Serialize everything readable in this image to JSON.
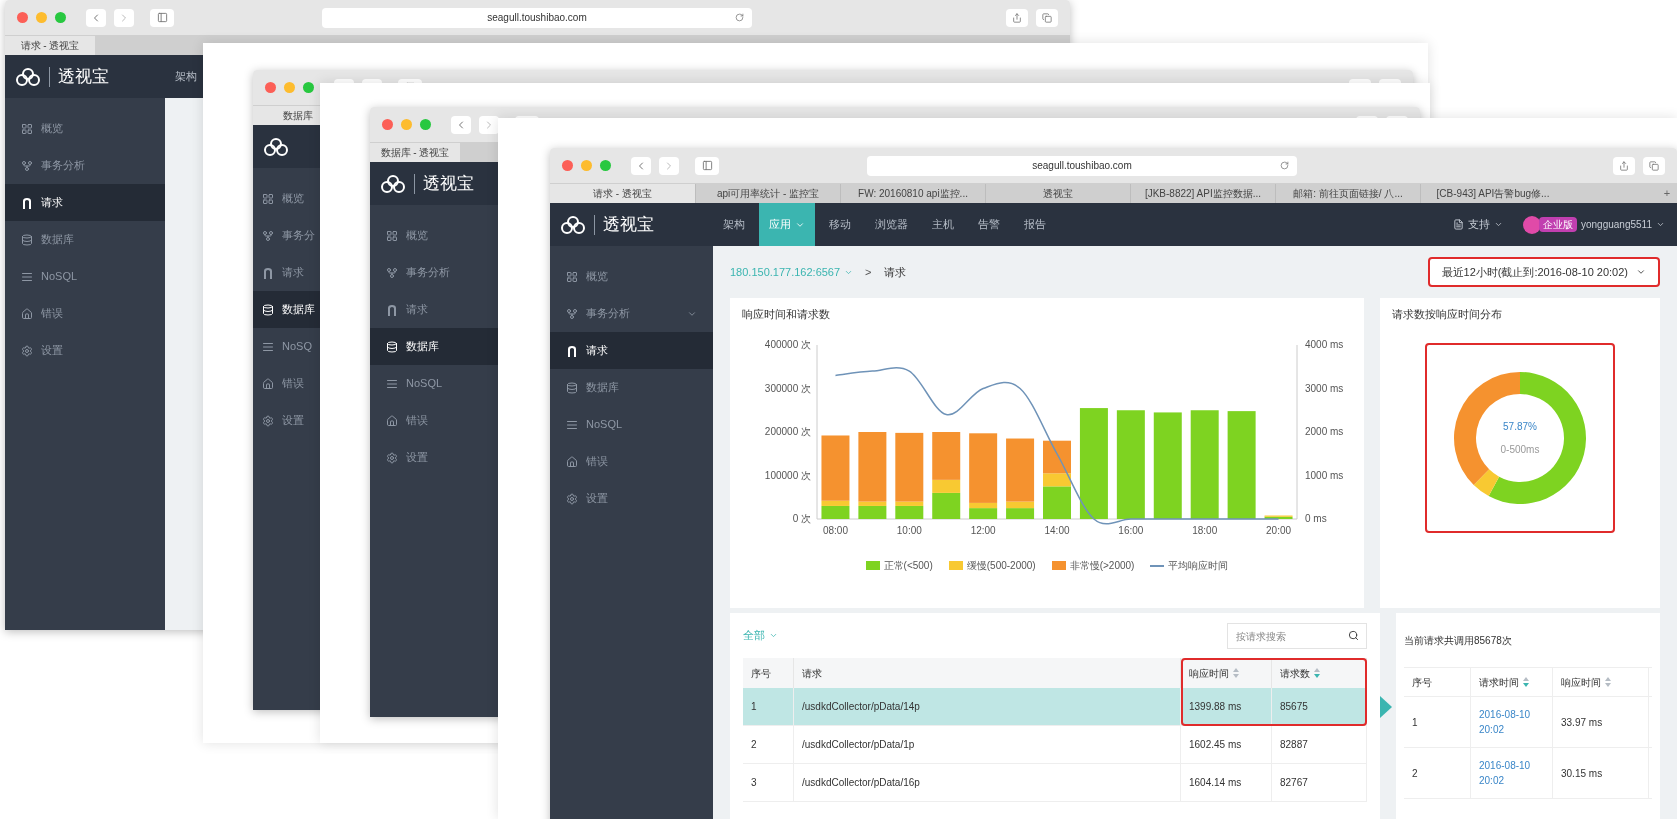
{
  "windows": [
    {
      "tabs": [
        {
          "label": "请求 - 透视宝",
          "selected": true
        }
      ],
      "url": "seagull.toushibao.com",
      "logo": "透视宝",
      "nav": [
        {
          "label": "架构",
          "selected": false
        }
      ],
      "sidebar": [
        {
          "kind": "overview",
          "label": "概览",
          "selected": false
        },
        {
          "kind": "transactions",
          "label": "事务分析",
          "selected": false
        },
        {
          "kind": "requests",
          "label": "请求",
          "selected": true
        },
        {
          "kind": "database",
          "label": "数据库",
          "selected": false
        },
        {
          "kind": "nosql",
          "label": "NoSQL",
          "selected": false
        },
        {
          "kind": "errors",
          "label": "错误",
          "selected": false
        },
        {
          "kind": "settings",
          "label": "设置",
          "selected": false
        }
      ]
    },
    {
      "tabs": [
        {
          "label": "数据库",
          "selected": true
        }
      ],
      "sidebar": [
        {
          "kind": "overview",
          "label": "概览",
          "selected": false
        },
        {
          "kind": "transactions",
          "label": "事务分",
          "selected": false
        },
        {
          "kind": "requests",
          "label": "请求",
          "selected": false
        },
        {
          "kind": "database",
          "label": "数据库",
          "selected": true
        },
        {
          "kind": "nosql",
          "label": "NoSQ",
          "selected": false
        },
        {
          "kind": "errors",
          "label": "错误",
          "selected": false
        },
        {
          "kind": "settings",
          "label": "设置",
          "selected": false
        }
      ]
    },
    {
      "tabs": [
        {
          "label": "数据库 - 透视宝",
          "selected": true
        }
      ],
      "logo": "透视宝",
      "sidebar": [
        {
          "kind": "overview",
          "label": "概览",
          "selected": false
        },
        {
          "kind": "transactions",
          "label": "事务分析",
          "selected": false
        },
        {
          "kind": "requests",
          "label": "请求",
          "selected": false
        },
        {
          "kind": "database",
          "label": "数据库",
          "selected": true
        },
        {
          "kind": "nosql",
          "label": "NoSQL",
          "selected": false
        },
        {
          "kind": "errors",
          "label": "错误",
          "selected": false
        },
        {
          "kind": "settings",
          "label": "设置",
          "selected": false
        }
      ]
    },
    {
      "tabs": [
        {
          "label": "请求 - 透视宝",
          "selected": true
        },
        {
          "label": "api可用率统计 - 监控宝",
          "selected": false
        },
        {
          "label": "FW: 20160810 api监控...",
          "selected": false
        },
        {
          "label": "透视宝",
          "selected": false
        },
        {
          "label": "[JKB-8822] API监控数据...",
          "selected": false
        },
        {
          "label": "邮箱: 前往页面链接/ 八...",
          "selected": false
        },
        {
          "label": "[CB-943] API告警bug修...",
          "selected": false
        }
      ],
      "new_tab": "+",
      "url": "seagull.toushibao.com",
      "logo": "透视宝",
      "nav": [
        {
          "label": "架构",
          "selected": false
        },
        {
          "label": "应用",
          "selected": true
        },
        {
          "label": "移动",
          "selected": false
        },
        {
          "label": "浏览器",
          "selected": false
        },
        {
          "label": "主机",
          "selected": false
        },
        {
          "label": "告警",
          "selected": false
        },
        {
          "label": "报告",
          "selected": false
        }
      ],
      "support": "支持",
      "edition": "企业版",
      "username": "yongguang5511",
      "sidebar": [
        {
          "kind": "overview",
          "label": "概览",
          "selected": false
        },
        {
          "kind": "transactions",
          "label": "事务分析",
          "selected": false,
          "has_children": true
        },
        {
          "kind": "requests",
          "label": "请求",
          "selected": true
        },
        {
          "kind": "database",
          "label": "数据库",
          "selected": false
        },
        {
          "kind": "nosql",
          "label": "NoSQL",
          "selected": false
        },
        {
          "kind": "errors",
          "label": "错误",
          "selected": false
        },
        {
          "kind": "settings",
          "label": "设置",
          "selected": false
        }
      ],
      "breadcrumb": {
        "host": "180.150.177.162:6567",
        "separator": ">",
        "page": "请求"
      },
      "time_range": {
        "value": "最近12小时(截止到:2016-08-10 20:02)",
        "highlighted": true
      },
      "trend_card": {
        "title": "响应时间和请求数",
        "chart_data": {
          "type": "bar",
          "stacked": true,
          "x": [
            8,
            9,
            10,
            11,
            12,
            13,
            14,
            15,
            16,
            17,
            18,
            19,
            20
          ],
          "xlim": [
            7.5,
            20.5
          ],
          "xticks": [
            {
              "value": 8,
              "label": "08:00"
            },
            {
              "value": 10,
              "label": "10:00"
            },
            {
              "value": 12,
              "label": "12:00"
            },
            {
              "value": 14,
              "label": "14:00"
            },
            {
              "value": 16,
              "label": "16:00"
            },
            {
              "value": 18,
              "label": "18:00"
            },
            {
              "value": 20,
              "label": "20:00"
            }
          ],
          "ylim": [
            0,
            400000
          ],
          "yticks": [
            {
              "value": 0,
              "label": "0 次"
            },
            {
              "value": 100000,
              "label": "100000 次"
            },
            {
              "value": 200000,
              "label": "200000 次"
            },
            {
              "value": 300000,
              "label": "300000 次"
            },
            {
              "value": 400000,
              "label": "400000 次"
            }
          ],
          "series": [
            {
              "name": "正常(<500)",
              "color": "#7ed321",
              "values": [
                30000,
                30000,
                30000,
                60000,
                25000,
                25000,
                75000,
                255000,
                250000,
                245000,
                250000,
                248000,
                5000
              ]
            },
            {
              "name": "缓慢(500-2000)",
              "color": "#f8c932",
              "values": [
                12000,
                10000,
                10000,
                30000,
                12000,
                15000,
                30000,
                0,
                0,
                0,
                0,
                0,
                3000
              ]
            },
            {
              "name": "非常慢(>2000)",
              "color": "#f5922f",
              "values": [
                150000,
                160000,
                158000,
                110000,
                160000,
                145000,
                75000,
                0,
                0,
                0,
                0,
                0,
                0
              ]
            }
          ]
        },
        "response_line": {
          "chart_data": {
            "type": "line",
            "x": [
              8,
              9,
              10,
              11,
              12,
              13,
              14,
              15,
              16,
              17,
              18,
              19,
              20
            ],
            "xlim": [
              7.5,
              20.5
            ],
            "ylim": [
              0,
              4000
            ],
            "yticks": [
              {
                "value": 0,
                "label": "0 ms"
              },
              {
                "value": 1000,
                "label": "1000 ms"
              },
              {
                "value": 2000,
                "label": "2000 ms"
              },
              {
                "value": 3000,
                "label": "3000 ms"
              },
              {
                "value": 4000,
                "label": "4000 ms"
              }
            ],
            "series": [
              {
                "name": "平均响应时间",
                "color": "#6f93b8",
                "values": [
                  3300,
                  3400,
                  3400,
                  2400,
                  3000,
                  3000,
                  1500,
                  0,
                  0,
                  0,
                  0,
                  0,
                  0
                ]
              }
            ]
          }
        }
      },
      "distribution_card": {
        "title": "请求数按响应时间分布",
        "highlighted": true,
        "center_value": "57.87%",
        "center_label": "0-500ms",
        "chart_data": {
          "type": "donut",
          "values": [
            57.87,
            4.5,
            37.63
          ],
          "colors": [
            "#7ed321",
            "#f8c932",
            "#f5922f"
          ]
        }
      },
      "requests_table": {
        "filter": "全部",
        "search": {
          "placeholder": "按请求搜索"
        },
        "columns": [
          {
            "label": "序号",
            "sortable": false,
            "highlighted": false
          },
          {
            "label": "请求",
            "sortable": false,
            "highlighted": false
          },
          {
            "label": "响应时间",
            "sortable": true,
            "sorted": false,
            "highlighted": true
          },
          {
            "label": "请求数",
            "sortable": true,
            "sorted": true,
            "highlighted": true
          }
        ],
        "rows": [
          {
            "cells": [
              "1",
              "/usdkdCollector/pData/14p",
              "1399.88 ms",
              "85675"
            ],
            "selected": true
          },
          {
            "cells": [
              "2",
              "/usdkdCollector/pData/1p",
              "1602.45 ms",
              "82887"
            ],
            "selected": false
          },
          {
            "cells": [
              "3",
              "/usdkdCollector/pData/16p",
              "1604.14 ms",
              "82767"
            ],
            "selected": false
          }
        ]
      },
      "calls_table": {
        "title": "当前请求共调用85678次",
        "columns": [
          {
            "label": "序号",
            "sortable": false
          },
          {
            "label": "请求时间",
            "sortable": true,
            "sorted": true
          },
          {
            "label": "响应时间",
            "sortable": true,
            "sorted": false
          }
        ],
        "rows": [
          {
            "cells": [
              "1",
              "2016-08-10 20:02",
              "33.97 ms"
            ]
          },
          {
            "cells": [
              "2",
              "2016-08-10 20:02",
              "30.15 ms"
            ]
          }
        ]
      }
    }
  ]
}
